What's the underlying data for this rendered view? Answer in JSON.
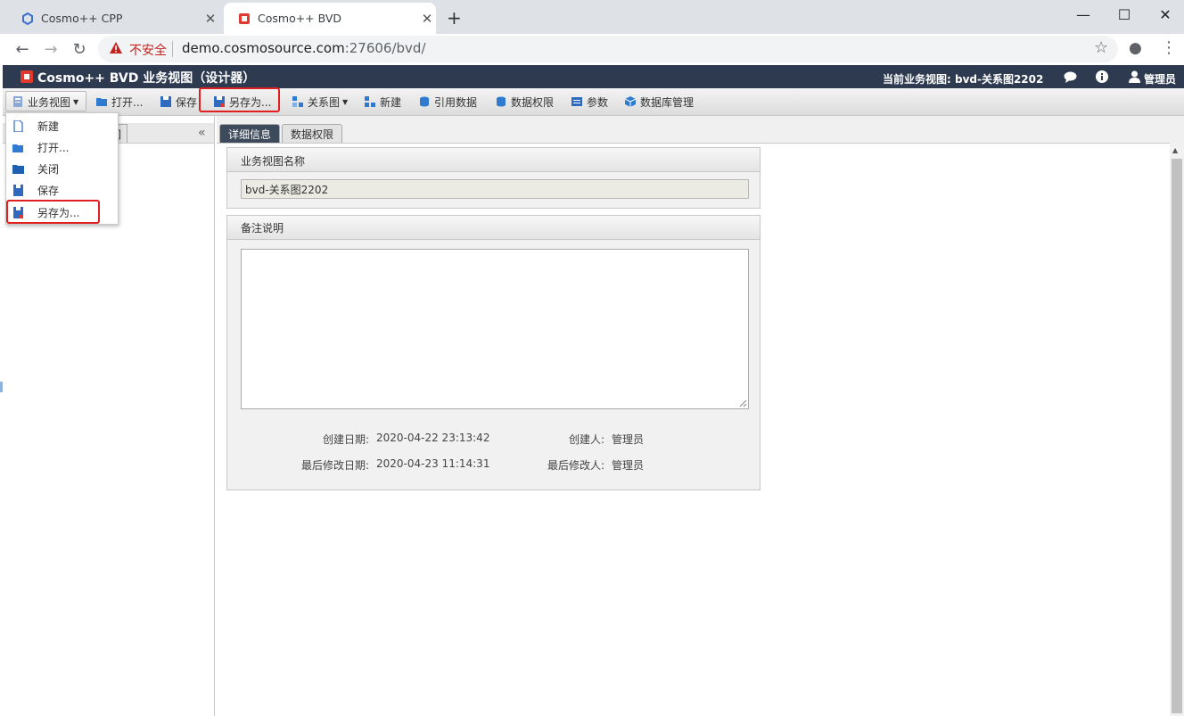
{
  "browser": {
    "tabs": [
      {
        "title": "Cosmo++ CPP",
        "close": "✕"
      },
      {
        "title": "Cosmo++ BVD",
        "close": "✕"
      }
    ],
    "new_tab": "+",
    "window_controls": {
      "minimize": "—",
      "maximize": "☐",
      "close": "✕"
    },
    "nav": {
      "back": "←",
      "forward": "→",
      "reload": "↻"
    },
    "security_label": "不安全",
    "url_host": "demo.cosmosource.com",
    "url_rest": ":27606/bvd/",
    "star": "☆",
    "account": "●",
    "menu": "⋮"
  },
  "app": {
    "title": "Cosmo++ BVD 业务视图（设计器）",
    "current_view": "当前业务视图: bvd-关系图2202",
    "user": "管理员",
    "brand_color": "#2e3a50",
    "accent_icon_color": "#e03a2f"
  },
  "toolbar": {
    "business_view": "业务视图",
    "open": "打开...",
    "save": "保存",
    "save_as": "另存为...",
    "relation": "关系图",
    "new": "新建",
    "ref_data": "引用数据",
    "data_perm": "数据权限",
    "params": "参数",
    "db_manage": "数据库管理"
  },
  "dropdown": {
    "items": [
      "新建",
      "打开...",
      "关闭",
      "保存",
      "另存为..."
    ]
  },
  "left_panel": {
    "tab_fragment": "间",
    "collapse": "«"
  },
  "main": {
    "tabs": [
      "详细信息",
      "数据权限"
    ],
    "name_section": "业务视图名称",
    "name_value": "bvd-关系图2202",
    "remark_section": "备注说明",
    "created_date_label": "创建日期:",
    "created_date": "2020-04-22 23:13:42",
    "creator_label": "创建人:",
    "creator": "管理员",
    "modified_date_label": "最后修改日期:",
    "modified_date": "2020-04-23 11:14:31",
    "modifier_label": "最后修改人:",
    "modifier": "管理员"
  }
}
